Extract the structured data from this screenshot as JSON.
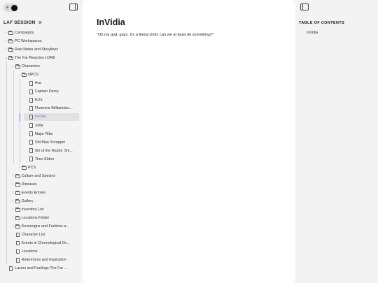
{
  "sidebar": {
    "session_title": "LAF SESSION",
    "tree": [
      {
        "label": "Campaigns",
        "type": "folder",
        "depth": 0,
        "expanded": false
      },
      {
        "label": "PC Workspaces",
        "type": "folder",
        "depth": 0,
        "expanded": false
      },
      {
        "label": "Raw Notes and Storylines",
        "type": "folder",
        "depth": 0,
        "expanded": false
      },
      {
        "label": "The Far Reaches LORE",
        "type": "folder",
        "depth": 0,
        "expanded": true
      },
      {
        "label": "Characters",
        "type": "folder",
        "depth": 1,
        "expanded": true
      },
      {
        "label": "NPCS",
        "type": "folder",
        "depth": 2,
        "expanded": true
      },
      {
        "label": "Ava",
        "type": "file",
        "depth": 3
      },
      {
        "label": "Captain Darcy",
        "type": "file",
        "depth": 3
      },
      {
        "label": "Ezra",
        "type": "file",
        "depth": 3
      },
      {
        "label": "Florencia Williamsbu...",
        "type": "file",
        "depth": 3
      },
      {
        "label": "InVidia",
        "type": "file",
        "depth": 3,
        "active": true
      },
      {
        "label": "Jollie",
        "type": "file",
        "depth": 3
      },
      {
        "label": "Major Ribs",
        "type": "file",
        "depth": 3
      },
      {
        "label": "Old Man Scrapper",
        "type": "file",
        "depth": 3
      },
      {
        "label": "Siri of the Raptor Shi...",
        "type": "file",
        "depth": 3
      },
      {
        "label": "Theo Eldon",
        "type": "file",
        "depth": 3
      },
      {
        "label": "PCS",
        "type": "folder",
        "depth": 2,
        "expanded": false
      },
      {
        "label": "Culture and Species",
        "type": "folder",
        "depth": 1,
        "expanded": false
      },
      {
        "label": "Diseases",
        "type": "folder",
        "depth": 1,
        "expanded": false
      },
      {
        "label": "Events Entries",
        "type": "folder",
        "depth": 1,
        "expanded": false
      },
      {
        "label": "Gallery",
        "type": "folder",
        "depth": 1,
        "expanded": false
      },
      {
        "label": "Inventory List",
        "type": "folder",
        "depth": 1,
        "expanded": false
      },
      {
        "label": "Locations Folder",
        "type": "folder",
        "depth": 1,
        "expanded": false
      },
      {
        "label": "Sovereigns and Factions a...",
        "type": "folder",
        "depth": 1,
        "expanded": false
      },
      {
        "label": "Character List",
        "type": "file",
        "depth": 1
      },
      {
        "label": "Events in Chronological Or...",
        "type": "file",
        "depth": 1
      },
      {
        "label": "Locations",
        "type": "file",
        "depth": 1
      },
      {
        "label": "References and Inspiration",
        "type": "file",
        "depth": 1
      },
      {
        "label": "Lasers and Feelings-The Far ...",
        "type": "file",
        "depth": 0
      }
    ]
  },
  "main": {
    "title": "InVidia",
    "quote": "\"Oh my god, guys. It's a literal child, can we at least do something?\""
  },
  "toc": {
    "heading": "TABLE OF CONTENTS",
    "items": [
      "InVidia"
    ]
  },
  "colors": {
    "accent": "#7b6fd6",
    "sidebar_bg": "#f3f3f3",
    "editor_bg": "#ffffff"
  }
}
